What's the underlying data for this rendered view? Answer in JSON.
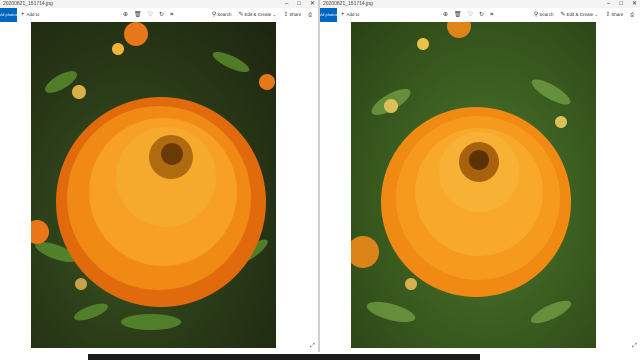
{
  "windows": [
    {
      "title": "20200821_151714.jpg",
      "all_photos_label": "All photos",
      "add_label": "Add to",
      "search_label": "Search",
      "edit_label": "Edit & Create ⌄",
      "share_label": "Share"
    },
    {
      "title": "20200821_151714.jpg",
      "all_photos_label": "All photos",
      "add_label": "Add to",
      "search_label": "Search",
      "edit_label": "Edit & Create ⌄",
      "share_label": "Share"
    }
  ],
  "icons": {
    "zoom": "zoom-icon",
    "delete": "delete-icon",
    "favorite": "heart-icon",
    "rotate": "rotate-icon",
    "crop": "crop-icon",
    "print": "print-icon"
  },
  "colors": {
    "accent": "#0067c0",
    "marigold": "#f7931e",
    "foliage": "#3b5d20"
  }
}
